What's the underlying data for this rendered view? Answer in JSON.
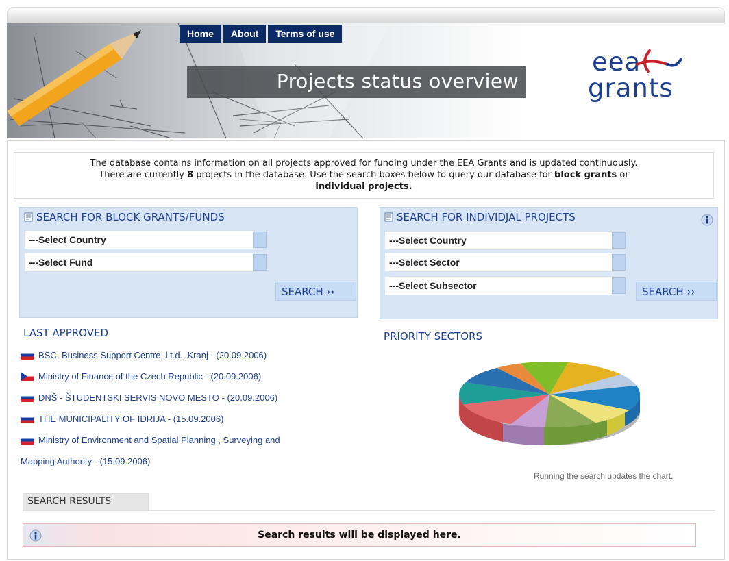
{
  "nav": [
    "Home",
    "About",
    "Terms of use"
  ],
  "header": {
    "title": "Projects status overview"
  },
  "logo": {
    "line1": "eea",
    "line2": "grants"
  },
  "intro": {
    "line1": "The database contains information on all projects approved for funding under the EEA Grants and is updated continuously.",
    "line2_pre": "There are currently ",
    "count": "8",
    "line2_mid": " projects in the database. Use the search boxes below to query our database for ",
    "block_grants": "block grants",
    "line2_or": " or",
    "individual": "individual projects",
    "period": "."
  },
  "block_search": {
    "title": "SEARCH FOR BLOCK GRANTS/FUNDS",
    "country": "---Select Country",
    "fund": "---Select Fund",
    "button": "SEARCH ››"
  },
  "individual_search": {
    "title": "SEARCH FOR INDIVIDJAL PROJECTS",
    "country": "---Select Country",
    "sector": "---Select Sector",
    "subsector": "---Select Subsector",
    "button": "SEARCH ››"
  },
  "last_approved": {
    "title": "LAST APPROVED",
    "items": [
      "BSC, Business Support Centre, l.t.d., Kranj - (20.09.2006)",
      "Ministry of Finance of the Czech Republic - (20.09.2006)",
      "DNŠ - ŠTUDENTSKI SERVIS NOVO MESTO - (20.09.2006)",
      "THE MUNICIPALITY OF IDRIJA - (15.09.2006)",
      "Ministry of Environment and Spatial Planning , Surveying and",
      "Mapping Authority - (15.09.2006)"
    ]
  },
  "priority": {
    "title": "PRIORITY SECTORS",
    "note": "Running the search updates the chart."
  },
  "results": {
    "tab": "SEARCH RESULTS",
    "message": "Search results will be displayed here."
  },
  "colors": {
    "nav_bg": "#0c2b66",
    "link": "#1c3f8e",
    "panel_bg": "#d7e5f5"
  }
}
